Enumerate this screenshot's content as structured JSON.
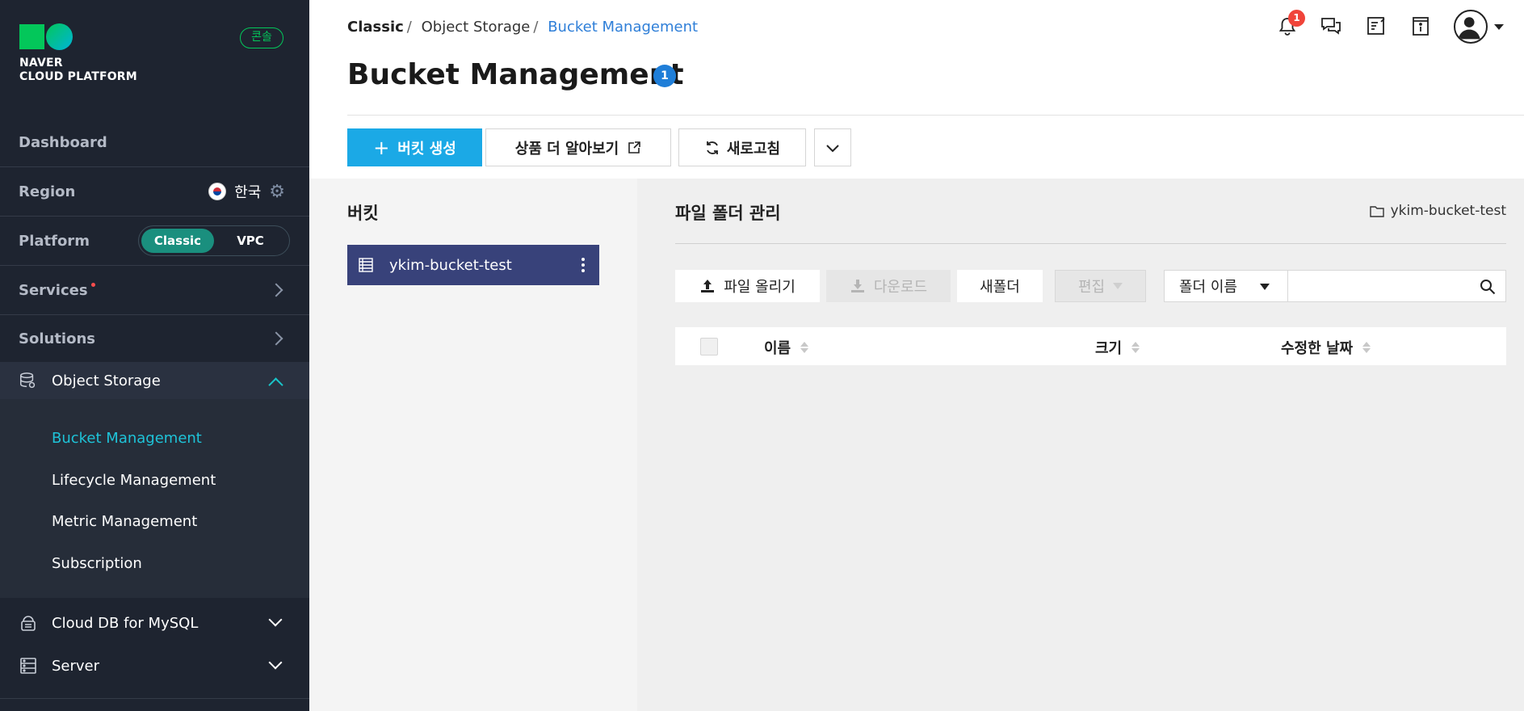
{
  "sidebar": {
    "logo": {
      "line1": "NAVER",
      "line2": "CLOUD PLATFORM"
    },
    "console_badge": "콘솔",
    "dashboard": "Dashboard",
    "region": {
      "label": "Region",
      "value": "한국"
    },
    "platform": {
      "label": "Platform",
      "options": [
        "Classic",
        "VPC"
      ],
      "selected": "Classic"
    },
    "services": "Services",
    "solutions": "Solutions",
    "object_storage": {
      "label": "Object Storage",
      "items": [
        "Bucket Management",
        "Lifecycle Management",
        "Metric Management",
        "Subscription"
      ],
      "active": "Bucket Management"
    },
    "cloud_db": "Cloud DB for MySQL",
    "server": "Server"
  },
  "header": {
    "breadcrumb": [
      "Classic",
      "Object Storage",
      "Bucket Management"
    ],
    "title": "Bucket Management",
    "title_badge": "1",
    "notification_count": "1",
    "icons": [
      "bell-icon",
      "chat-icon",
      "memo-icon",
      "info-icon",
      "user-avatar-icon"
    ]
  },
  "toolbar": {
    "create_bucket": "버킷 생성",
    "learn_more": "상품 더 알아보기",
    "refresh": "새로고침"
  },
  "bucket_panel": {
    "heading": "버킷",
    "buckets": [
      "ykim-bucket-test"
    ]
  },
  "file_panel": {
    "heading": "파일 폴더 관리",
    "path": "ykim-bucket-test",
    "upload": "파일 올리기",
    "download": "다운로드",
    "new_folder": "새폴더",
    "edit": "편집",
    "search_select": "폴더 이름",
    "search_value": "",
    "columns": [
      "이름",
      "크기",
      "수정한 날짜"
    ]
  },
  "colors": {
    "sidebar_bg": "#1e2430",
    "accent_teal": "#1ec3d8",
    "primary_blue": "#1ba9e6",
    "bucket_selected": "#38427a",
    "platform_active": "#1a8f7e"
  }
}
